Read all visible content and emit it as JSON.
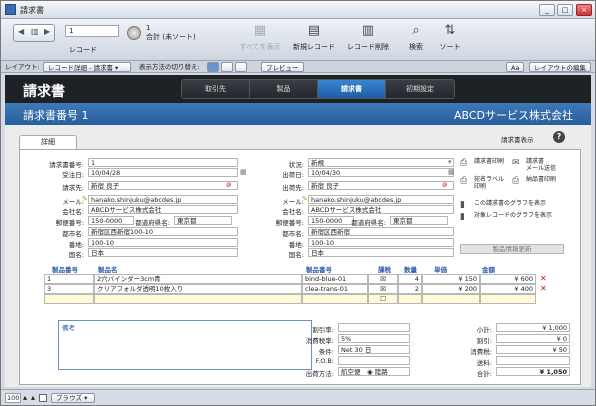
{
  "window": {
    "title": "請求書",
    "min": "_",
    "max": "□",
    "close": "×"
  },
  "toolbar": {
    "record_value": "1",
    "record_label": "レコード",
    "count": "1",
    "count_label": "合計 (未ソート)",
    "buttons": [
      {
        "label": "すべてを表示",
        "icon": "show-all-icon",
        "glyph": "▦",
        "disabled": true
      },
      {
        "label": "新規レコード",
        "icon": "new-record-icon",
        "glyph": "▤",
        "disabled": false
      },
      {
        "label": "レコード削除",
        "icon": "delete-record-icon",
        "glyph": "▥",
        "disabled": false
      },
      {
        "label": "検索",
        "icon": "search-icon",
        "glyph": "⌕",
        "disabled": false
      },
      {
        "label": "ソート",
        "icon": "sort-icon",
        "glyph": "⇅",
        "disabled": false
      }
    ]
  },
  "layoutbar": {
    "layout_label": "レイアウト:",
    "layout_value": "レコード詳細 - 請求書",
    "view_label": "表示方法の切り替え:",
    "preview": "プレビュー",
    "aa": "Aa",
    "edit_layout": "レイアウトの編集"
  },
  "header": {
    "title": "請求書",
    "tabs": [
      "取引先",
      "製品",
      "請求書",
      "初期設定"
    ],
    "active_tab": 2
  },
  "band": {
    "left": "請求書番号 1",
    "right": "ABCDサービス株式会社"
  },
  "panel": {
    "tab": "詳細",
    "select_display": "請求書表示",
    "help": "?"
  },
  "left_fields": [
    {
      "label": "請求書番号:",
      "value": "1"
    },
    {
      "label": "受注日:",
      "value": "10/04/28"
    },
    {
      "label": "請求先:",
      "value": "新宿 良子"
    },
    {
      "label": "メール:",
      "value": "hanako.shinjuku@abcdes.jp"
    },
    {
      "label": "会社名:",
      "value": "ABCDサービス株式会社"
    },
    {
      "label": "郵便番号:",
      "value": "150-0000"
    },
    {
      "label": "都道府県名:",
      "value": "東京都"
    },
    {
      "label": "都市名:",
      "value": "新宿区西新宿100-10"
    },
    {
      "label": "番地:",
      "value": "100-10"
    },
    {
      "label": "国名:",
      "value": "日本"
    }
  ],
  "right_fields": [
    {
      "label": "状況:",
      "value": "新規"
    },
    {
      "label": "出荷日:",
      "value": "10/04/30"
    },
    {
      "label": "出荷先:",
      "value": "新宿 良子"
    },
    {
      "label": "メール:",
      "value": "hanako.shinjuku@abcdes.jp"
    },
    {
      "label": "会社名:",
      "value": "ABCDサービス株式会社"
    },
    {
      "label": "郵便番号:",
      "value": "150-0000"
    },
    {
      "label": "都道府県名:",
      "value": "東京都"
    },
    {
      "label": "都市名:",
      "value": "新宿区西新宿"
    },
    {
      "label": "番地:",
      "value": "100-10"
    },
    {
      "label": "国名:",
      "value": "日本"
    }
  ],
  "actions": [
    {
      "label": "請求書印刷",
      "icon": "printer-icon",
      "glyph": "⎙"
    },
    {
      "label": "請求書\nメール送信",
      "icon": "mail-icon",
      "glyph": "✉"
    },
    {
      "label": "宛名ラベル\n印刷",
      "icon": "printer-icon",
      "glyph": "⎙"
    },
    {
      "label": "納品書印刷",
      "icon": "printer-icon",
      "glyph": "⎙"
    },
    {
      "label": "この請求書のグラフを表示",
      "icon": "chart-icon",
      "glyph": "▮"
    },
    {
      "label": "対象レコードのグラフを表示",
      "icon": "chart-icon",
      "glyph": "▮"
    }
  ],
  "update_button": "製品情報更新",
  "table": {
    "headers": [
      "製品番号",
      "製品名",
      "製品番号",
      "課税",
      "数量",
      "単価",
      "金額"
    ],
    "rows": [
      [
        "1",
        "2穴バインダー3cm青",
        "bind-blue-01",
        "☒",
        "4",
        "¥ 150",
        "¥ 600"
      ],
      [
        "3",
        "クリアフォルダ透明10枚入り",
        "clea-trans-01",
        "☒",
        "2",
        "¥ 200",
        "¥ 400"
      ]
    ],
    "new_row_tax": "☐"
  },
  "memo": {
    "label": "備考",
    "text": ""
  },
  "mid_fields": [
    {
      "label": "割引率:",
      "value": ""
    },
    {
      "label": "消費税率:",
      "value": "5%"
    },
    {
      "label": "条件:",
      "value": "Net 30 日"
    },
    {
      "label": "F.O.B:",
      "value": ""
    },
    {
      "label": "出荷方法:",
      "value": "航空便　◉ 陸路"
    }
  ],
  "totals": [
    {
      "label": "小計:",
      "value": "¥ 1,000"
    },
    {
      "label": "割引:",
      "value": "¥ 0"
    },
    {
      "label": "消費税:",
      "value": "¥ 50"
    },
    {
      "label": "送料:",
      "value": ""
    },
    {
      "label": "合計:",
      "value": "¥ 1,050"
    }
  ],
  "status": {
    "zoom": "100",
    "mode": "ブラウズ"
  }
}
